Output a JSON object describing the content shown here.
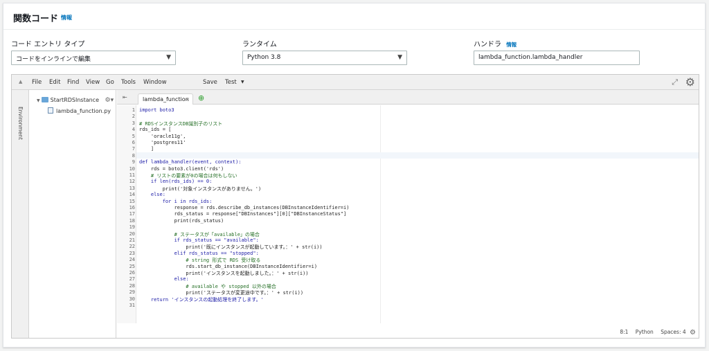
{
  "header": {
    "title": "関数コード",
    "info": "情報"
  },
  "fields": {
    "entry_type": {
      "label": "コード エントリ タイプ",
      "value": "コードをインラインで編集"
    },
    "runtime": {
      "label": "ランタイム",
      "value": "Python 3.8"
    },
    "handler": {
      "label": "ハンドラ",
      "info": "情報",
      "value": "lambda_function.lambda_handler"
    }
  },
  "ide": {
    "menu": [
      "File",
      "Edit",
      "Find",
      "View",
      "Go",
      "Tools",
      "Window",
      "Save",
      "Test"
    ],
    "environment_label": "Environment",
    "tree": {
      "folder": "StartRDSInstance",
      "file": "lambda_function.py"
    },
    "tab": "lambda_function",
    "status": {
      "position": "8:1",
      "language": "Python",
      "spaces": "Spaces: 4"
    }
  },
  "code_lines": [
    "import boto3",
    "",
    "# RDSインスタンスDB識別子のリスト",
    "rds_ids = [",
    "    'oracle11g',",
    "    'postgres11'",
    "    ]",
    "",
    "def lambda_handler(event, context):",
    "    rds = boto3.client('rds')",
    "    # リストの要素が0の場合は何もしない",
    "    if len(rds_ids) == 0:",
    "        print('対象インスタンスがありません。')",
    "    else:",
    "        for i in rds_ids:",
    "            response = rds.describe_db_instances(DBInstanceIdentifier=i)",
    "            rds_status = response[\"DBInstances\"][0][\"DBInstanceStatus\"]",
    "            print(rds_status)",
    "",
    "            # ステータスが「available」の場合",
    "            if rds_status == \"available\":",
    "                print('既にインスタンスが起動しています。：' + str(i))",
    "            elif rds_status == \"stopped\":",
    "                # string 形式で RDS 受け取る",
    "                rds.start_db_instance(DBInstanceIdentifier=i)",
    "                print('インスタンスを起動しました。：' + str(i))",
    "            else:",
    "                # available や stopped 以外の場合",
    "                print('ステータスが変更途中です。：' + str(i))",
    "    return 'インスタンスの起動処理を終了します。'",
    ""
  ]
}
